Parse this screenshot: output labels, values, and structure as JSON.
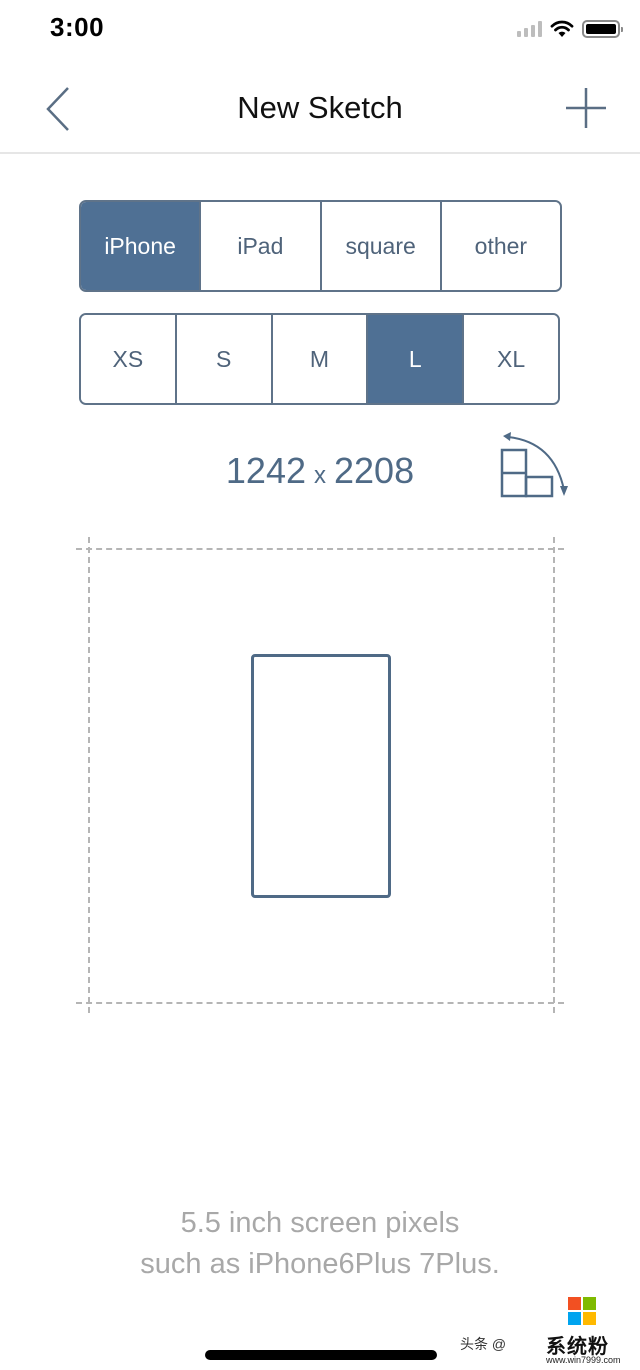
{
  "status_bar": {
    "time": "3:00",
    "icons": [
      "signal-icon",
      "wifi-icon",
      "battery-icon"
    ]
  },
  "nav": {
    "title": "New Sketch",
    "back_icon": "chevron-left-icon",
    "add_icon": "plus-icon"
  },
  "device_types": {
    "options": [
      "iPhone",
      "iPad",
      "square",
      "other"
    ],
    "selected": "iPhone"
  },
  "sizes": {
    "options": [
      "XS",
      "S",
      "M",
      "L",
      "XL"
    ],
    "selected": "L"
  },
  "dimensions": {
    "width": "1242",
    "separator": "x",
    "height": "2208",
    "rotate_icon": "rotate-orientation-icon"
  },
  "description": {
    "line1": "5.5 inch screen pixels",
    "line2": "such as iPhone6Plus 7Plus."
  },
  "watermark": {
    "text": "头条 @",
    "brand": "系统粉",
    "url": "www.win7999.com",
    "logo_colors": [
      "#f25022",
      "#7fba00",
      "#00a4ef",
      "#ffb900"
    ]
  },
  "colors": {
    "accent": "#4f7094",
    "border": "#5f7389",
    "text_secondary": "#a8a8a8"
  }
}
